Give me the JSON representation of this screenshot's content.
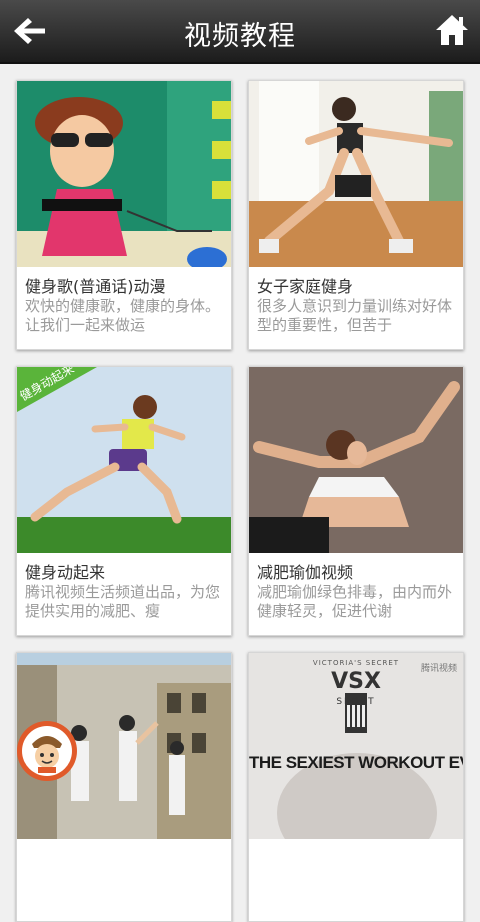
{
  "header": {
    "title": "视频教程",
    "back_icon": "arrow-left-icon",
    "home_icon": "home-icon"
  },
  "colors": {
    "header_dark": "#1c1c1c",
    "card_bg": "#ffffff",
    "desc_text": "#9a9a9a",
    "badge_green": "#5ab43a",
    "avatar_ring": "#e05a2a"
  },
  "cards": [
    {
      "title": "健身歌(普通话)动漫",
      "desc": "欢快的健康歌，健康的身体。让我们一起来做运"
    },
    {
      "title": "女子家庭健身",
      "desc": "很多人意识到力量训练对好体型的重要性，但苦于"
    },
    {
      "title": "健身动起来",
      "desc": "腾讯视频生活频道出品，为您提供实用的减肥、瘦",
      "badge": "健身动起来"
    },
    {
      "title": "减肥瑜伽视频",
      "desc": "减肥瑜伽绿色排毒，由内而外健康轻灵，促进代谢"
    },
    {
      "title": "",
      "desc": ""
    },
    {
      "title": "",
      "desc": "",
      "overlay_top": "VICTORIA'S SECRET",
      "overlay_brand": "VSX",
      "overlay_sub": "SPORT",
      "overlay_main": "THE SEXIEST WORKOUT EVER",
      "overlay_logo": "腾讯视频"
    }
  ]
}
